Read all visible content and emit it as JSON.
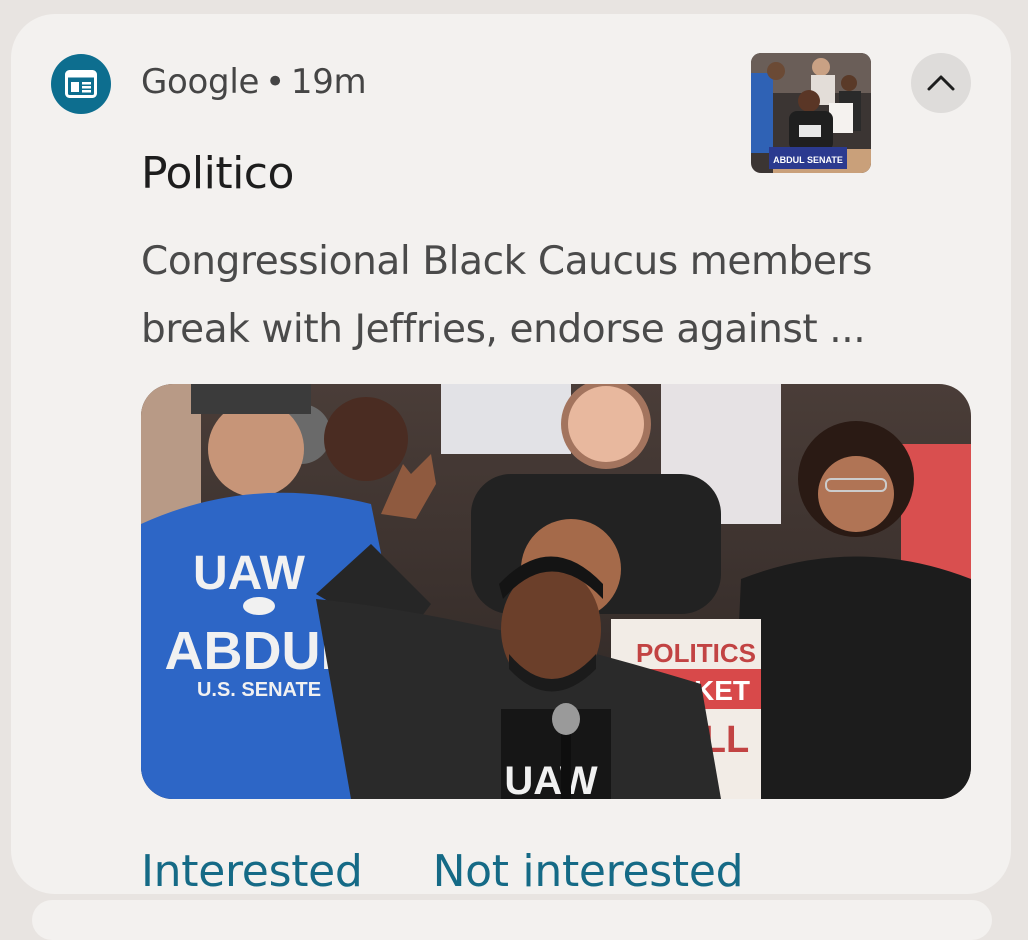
{
  "notification": {
    "app_name": "Google",
    "separator": "•",
    "time_ago": "19m",
    "title": "Politico",
    "body": "Congressional Black Caucus members break with Jeffries, endorse against ...",
    "icons": {
      "app": "news-icon",
      "collapse": "chevron-up-icon"
    },
    "actions": {
      "interested": "Interested",
      "not_interested": "Not interested"
    }
  },
  "image_signs": {
    "shirt_line1": "UAW",
    "shirt_line2": "ABDUL",
    "shirt_line3": "U.S. SENATE",
    "sign_line1": "POLITICS",
    "sign_line2": "OCKET",
    "sign_line3": "LL",
    "speaker_shirt": "UAW",
    "thumb_banner": "ABDUL SENATE"
  },
  "colors": {
    "accent": "#156a86",
    "app_icon_bg": "#0d6e8f",
    "card_bg": "#f3f1ef"
  }
}
